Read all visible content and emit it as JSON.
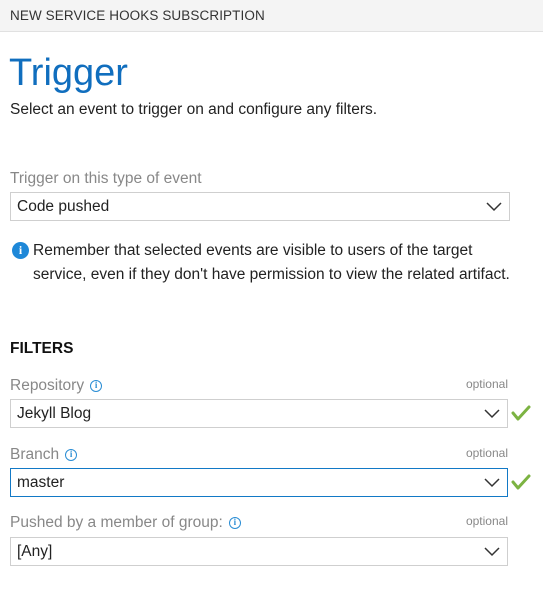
{
  "window": {
    "title": "NEW SERVICE HOOKS SUBSCRIPTION"
  },
  "trigger": {
    "heading": "Trigger",
    "description": "Select an event to trigger on and configure any filters.",
    "event_label": "Trigger on this type of event",
    "event_value": "Code pushed"
  },
  "notice": {
    "icon": "info-icon",
    "text": "Remember that selected events are visible to users of the target service, even if they don't have permission to view the related artifact."
  },
  "filters": {
    "heading": "FILTERS",
    "items": [
      {
        "label": "Repository",
        "optional": "optional",
        "value": "Jekyll Blog",
        "valid": true,
        "focused": false
      },
      {
        "label": "Branch",
        "optional": "optional",
        "value": "master",
        "valid": true,
        "focused": true
      },
      {
        "label": "Pushed by a member of group:",
        "optional": "optional",
        "value": "[Any]",
        "valid": false,
        "focused": false
      }
    ]
  },
  "colors": {
    "accent": "#106ebe",
    "info": "#1e88d8",
    "valid_check": "#7cb342",
    "focus_border": "#1279c6"
  }
}
